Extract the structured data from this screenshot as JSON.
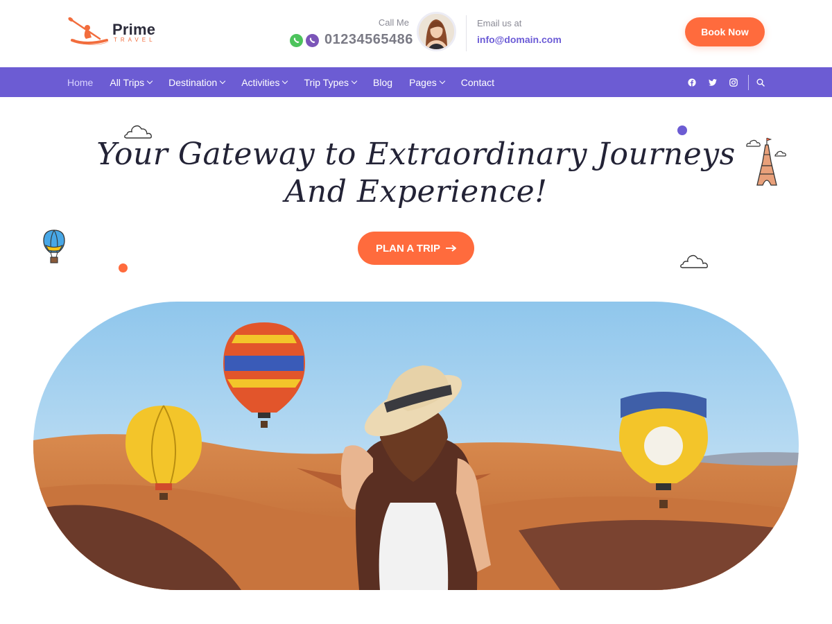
{
  "header": {
    "logo": {
      "name": "Prime",
      "tagline": "TRAVEL"
    },
    "call": {
      "label": "Call Me",
      "number": "01234565486",
      "icons": [
        "whatsapp-icon",
        "viber-icon"
      ]
    },
    "email": {
      "label": "Email us at",
      "address": "info@domain.com"
    },
    "book_button": "Book Now"
  },
  "nav": {
    "items": [
      {
        "label": "Home",
        "dropdown": false
      },
      {
        "label": "All Trips",
        "dropdown": true
      },
      {
        "label": "Destination",
        "dropdown": true
      },
      {
        "label": "Activities",
        "dropdown": true
      },
      {
        "label": "Trip Types",
        "dropdown": true
      },
      {
        "label": "Blog",
        "dropdown": false
      },
      {
        "label": "Pages",
        "dropdown": true
      },
      {
        "label": "Contact",
        "dropdown": false
      }
    ],
    "social_icons": [
      "facebook-icon",
      "twitter-icon",
      "instagram-icon"
    ],
    "search_icon": "search-icon"
  },
  "hero": {
    "title_line1": "Your Gateway to Extraordinary Journeys",
    "title_line2": "And Experience!",
    "cta": "PLAN A TRIP"
  },
  "colors": {
    "accent": "#ff6b3d",
    "nav_bg": "#6c5cd3",
    "email_text": "#6b5bd6",
    "title_text": "#232336"
  }
}
